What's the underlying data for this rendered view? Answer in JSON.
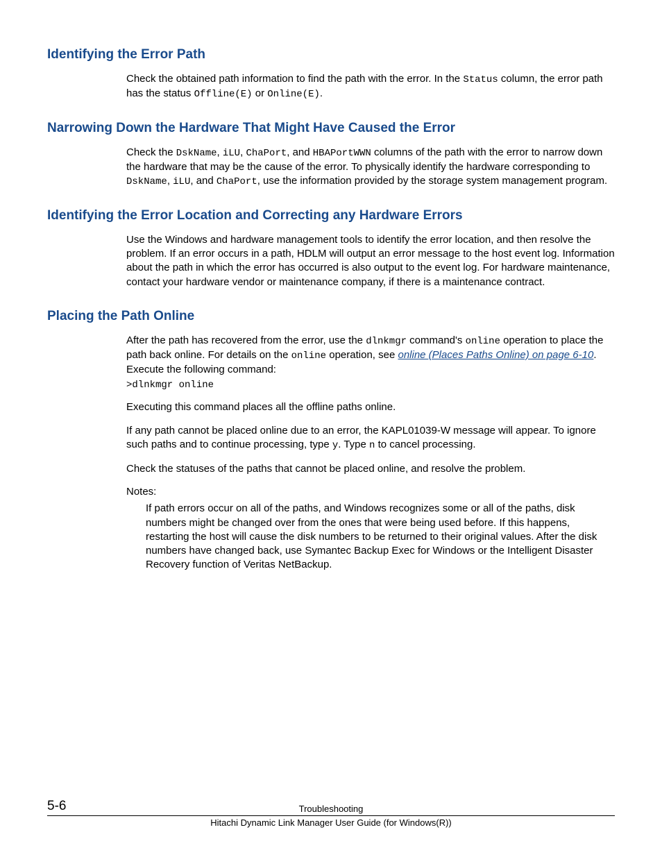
{
  "sections": {
    "s1": {
      "heading": "Identifying the Error Path",
      "p1a": "Check the obtained path information to find the path with the error. In the ",
      "p1b": " column, the error path has the status ",
      "p1c": " or ",
      "p1d": ".",
      "code_status": "Status",
      "code_offline": "Offline(E)",
      "code_online": "Online(E)"
    },
    "s2": {
      "heading": "Narrowing Down the Hardware That Might Have Caused the Error",
      "p1a": "Check the ",
      "p1b": ", ",
      "p1c": ", ",
      "p1d": ", and ",
      "p1e": " columns of the path with the error to narrow down the hardware that may be the cause of the error. To physically identify the hardware corresponding to ",
      "p1f": ", ",
      "p1g": ", and ",
      "p1h": ", use the information provided by the storage system management program.",
      "code_dskname": "DskName",
      "code_ilu": "iLU",
      "code_chaport": "ChaPort",
      "code_hbaportwwn": "HBAPortWWN"
    },
    "s3": {
      "heading": "Identifying the Error Location and Correcting any Hardware Errors",
      "p1": "Use the Windows and hardware management tools to identify the error location, and then resolve the problem. If an error occurs in a path, HDLM will output an error message to the host event log. Information about the path in which the error has occurred is also output to the event log. For hardware maintenance, contact your hardware vendor or maintenance company, if there is a maintenance contract."
    },
    "s4": {
      "heading": "Placing the Path Online",
      "p1a": "After the path has recovered from the error, use the ",
      "p1b": " command's ",
      "p1c": " operation to place the path back online. For details on the ",
      "p1d": " operation, see ",
      "p1e": ". Execute the following command:",
      "code_dlnkmgr": "dlnkmgr",
      "code_online": "online",
      "link": "online (Places Paths Online) on page 6-10",
      "cmd": ">dlnkmgr online",
      "p2": "Executing this command places all the offline paths online.",
      "p3a": "If any path cannot be placed online due to an error, the KAPL01039-W message will appear. To ignore such paths and to continue processing, type ",
      "p3b": ". Type ",
      "p3c": " to cancel processing.",
      "code_y": "y",
      "code_n": "n",
      "p4": "Check the statuses of the paths that cannot be placed online, and resolve the problem.",
      "notes_label": "Notes:",
      "note1": "If path errors occur on all of the paths, and Windows recognizes some or all of the paths, disk numbers might be changed over from the ones that were being used before. If this happens, restarting the host will cause the disk numbers to be returned to their original values. After the disk numbers have changed back, use Symantec Backup Exec for Windows or the Intelligent Disaster Recovery function of Veritas NetBackup."
    }
  },
  "footer": {
    "page": "5-6",
    "title": "Troubleshooting",
    "sub": "Hitachi Dynamic Link Manager User Guide (for Windows(R))"
  }
}
